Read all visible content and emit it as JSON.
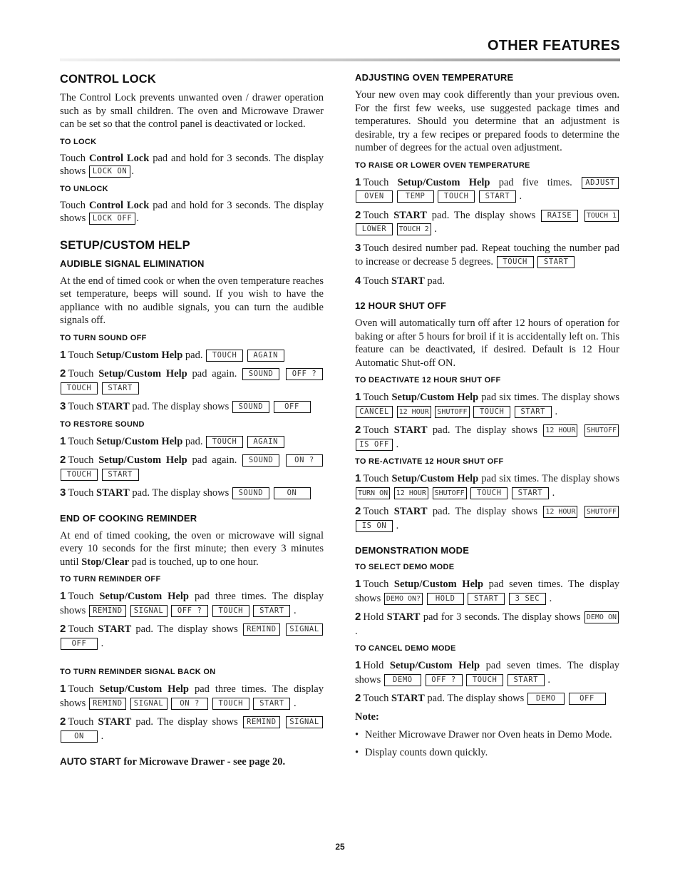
{
  "header": {
    "title": "OTHER FEATURES"
  },
  "control_lock": {
    "title": "CONTROL LOCK",
    "intro": "The Control Lock prevents unwanted oven / drawer operation such as by small children. The oven and Microwave Drawer can be set so that the control panel is deactivated or locked.",
    "to_lock": {
      "title": "TO LOCK",
      "pre": "Touch ",
      "bold": "Control Lock",
      "post": " pad and hold for 3 seconds. The display shows ",
      "display": "LOCK ON",
      "end": "."
    },
    "to_unlock": {
      "title": "TO UNLOCK",
      "pre": "Touch ",
      "bold": "Control Lock",
      "post": " pad and hold for 3 seconds. The display shows ",
      "display": "LOCK OFF",
      "end": "."
    }
  },
  "setup_help": {
    "title": "SETUP/CUSTOM HELP",
    "audible": {
      "title": "AUDIBLE SIGNAL ELIMINATION",
      "intro": "At the end of timed cook or when the oven temperature reaches set temperature, beeps will sound. If you wish to have the appliance with no audible signals, you can turn the audible signals off."
    },
    "sound_off": {
      "title": "TO TURN SOUND OFF",
      "steps": [
        {
          "num": "1",
          "pre": "Touch ",
          "bold": "Setup/Custom Help",
          "post": " pad. ",
          "displays": [
            "TOUCH",
            "AGAIN"
          ]
        },
        {
          "num": "2",
          "pre": "Touch ",
          "bold": "Setup/Custom Help",
          "post": " pad again. ",
          "displays": [
            "SOUND",
            "OFF ?",
            "TOUCH",
            "START"
          ]
        },
        {
          "num": "3",
          "pre": "Touch ",
          "bold": "START",
          "post": " pad. The display shows ",
          "displays": [
            "SOUND",
            "OFF"
          ]
        }
      ]
    },
    "restore_sound": {
      "title": "TO RESTORE SOUND",
      "steps": [
        {
          "num": "1",
          "pre": "Touch ",
          "bold": "Setup/Custom Help",
          "post": " pad. ",
          "displays": [
            "TOUCH",
            "AGAIN"
          ]
        },
        {
          "num": "2",
          "pre": "Touch ",
          "bold": "Setup/Custom Help",
          "post": " pad again. ",
          "displays": [
            "SOUND",
            "ON ?",
            "TOUCH",
            "START"
          ]
        },
        {
          "num": "3",
          "pre": "Touch ",
          "bold": "START",
          "post": " pad. The display shows ",
          "displays": [
            "SOUND",
            "ON"
          ]
        }
      ]
    }
  },
  "end_reminder": {
    "title": "END OF COOKING REMINDER",
    "intro_pre": "At end of timed cooking, the oven or microwave will signal every 10 seconds for the first minute; then every 3 minutes until ",
    "intro_bold": "Stop/Clear",
    "intro_post": " pad is touched, up to one hour.",
    "off": {
      "title": "TO TURN REMINDER OFF",
      "steps": [
        {
          "num": "1",
          "pre": "Touch ",
          "bold": "Setup/Custom Help",
          "post": " pad three times. The display shows ",
          "displays": [
            "REMIND",
            "SIGNAL",
            "OFF ?",
            "TOUCH",
            "START"
          ],
          "end": "."
        },
        {
          "num": "2",
          "pre": "Touch ",
          "bold": "START",
          "post": " pad. The display shows ",
          "displays": [
            "REMIND",
            "SIGNAL",
            "OFF"
          ],
          "end": "."
        }
      ]
    },
    "on": {
      "title": "TO TURN REMINDER SIGNAL BACK ON",
      "steps": [
        {
          "num": "1",
          "pre": "Touch ",
          "bold": "Setup/Custom Help",
          "post": " pad three times. The display shows ",
          "displays": [
            "REMIND",
            "SIGNAL",
            "ON ?",
            "TOUCH",
            "START"
          ],
          "end": "."
        },
        {
          "num": "2",
          "pre": "Touch ",
          "bold": "START",
          "post": " pad. The display shows ",
          "displays": [
            "REMIND",
            "SIGNAL",
            "ON"
          ],
          "end": "."
        }
      ]
    }
  },
  "auto_start": {
    "bold": "AUTO START",
    "text": " for Microwave Drawer - see page 20."
  },
  "adjust_temp": {
    "title": "ADJUSTING OVEN TEMPERATURE",
    "intro": "Your new oven may cook differently than your previous oven. For the first few weeks, use suggested package times and temperatures. Should you determine that an adjustment is desirable, try a few recipes or prepared foods to determine the number of degrees for the actual oven adjustment.",
    "raise_lower": {
      "title": "TO RAISE OR LOWER OVEN TEMPERATURE",
      "steps": [
        {
          "num": "1",
          "pre": "Touch ",
          "bold": "Setup/Custom Help",
          "post": " pad five times. ",
          "displays": [
            "ADJUST",
            "OVEN",
            "TEMP",
            "TOUCH",
            "START"
          ],
          "end": "."
        },
        {
          "num": "2",
          "pre": "Touch ",
          "bold": "START",
          "post": " pad. The display shows ",
          "displays": [
            "RAISE",
            "TOUCH 1",
            "LOWER",
            "TOUCH 2"
          ],
          "end": "."
        },
        {
          "num": "3",
          "pre": "Touch desired number pad. Repeat touching the number pad to increase or decrease 5 degrees. ",
          "bold": "",
          "post": "",
          "displays": [
            "TOUCH",
            "START"
          ]
        },
        {
          "num": "4",
          "pre": "Touch ",
          "bold": "START",
          "post": " pad.",
          "displays": []
        }
      ]
    }
  },
  "shut_off": {
    "title": "12 HOUR SHUT OFF",
    "intro": "Oven will automatically turn off after 12 hours of operation for baking or after 5 hours for broil if it is accidentally left on. This feature can be deactivated, if desired. Default is 12 Hour Automatic Shut-off ON.",
    "deactivate": {
      "title": "TO DEACTIVATE 12 HOUR SHUT OFF",
      "steps": [
        {
          "num": "1",
          "pre": "Touch ",
          "bold": "Setup/Custom Help",
          "post": " pad six times. The display shows ",
          "displays": [
            "CANCEL",
            "12 HOUR",
            "SHUTOFF",
            "TOUCH",
            "START"
          ],
          "end": "."
        },
        {
          "num": "2",
          "pre": "Touch ",
          "bold": "START",
          "post": " pad. The display shows ",
          "displays": [
            "12 HOUR",
            "SHUTOFF",
            "IS OFF"
          ],
          "end": "."
        }
      ]
    },
    "reactivate": {
      "title": "TO RE-ACTIVATE 12 HOUR SHUT OFF",
      "steps": [
        {
          "num": "1",
          "pre": "Touch ",
          "bold": "Setup/Custom Help",
          "post": " pad six times. The display shows ",
          "displays": [
            "TURN ON",
            "12 HOUR",
            "SHUTOFF",
            "TOUCH",
            "START"
          ],
          "end": "."
        },
        {
          "num": "2",
          "pre": "Touch ",
          "bold": "START",
          "post": " pad. The display shows ",
          "displays": [
            "12 HOUR",
            "SHUTOFF",
            "IS ON"
          ],
          "end": "."
        }
      ]
    }
  },
  "demo": {
    "title": "DEMONSTRATION MODE",
    "select": {
      "title": "TO SELECT DEMO MODE",
      "steps": [
        {
          "num": "1",
          "pre": "Touch ",
          "bold": "Setup/Custom Help",
          "post": " pad seven times. The display shows ",
          "displays": [
            "DEMO ON?",
            "HOLD",
            "START",
            "3 SEC"
          ],
          "end": "."
        },
        {
          "num": "2",
          "pre": "Hold ",
          "bold": "START",
          "post": " pad for 3 seconds. The display shows ",
          "displays": [
            "DEMO ON"
          ],
          "end": "."
        }
      ]
    },
    "cancel": {
      "title": "TO CANCEL DEMO MODE",
      "steps": [
        {
          "num": "1",
          "pre": "Hold ",
          "bold": "Setup/Custom Help",
          "post": " pad seven times. The display shows ",
          "displays": [
            "DEMO",
            "OFF ?",
            "TOUCH",
            "START"
          ],
          "end": "."
        },
        {
          "num": "2",
          "pre": "Touch ",
          "bold": "START",
          "post": " pad. The display shows ",
          "displays": [
            "DEMO",
            "OFF"
          ]
        }
      ]
    },
    "note_title": "Note:",
    "notes": [
      "Neither Microwave Drawer nor Oven heats in Demo Mode.",
      "Display counts down quickly."
    ]
  },
  "footer": {
    "page_number": "25"
  }
}
